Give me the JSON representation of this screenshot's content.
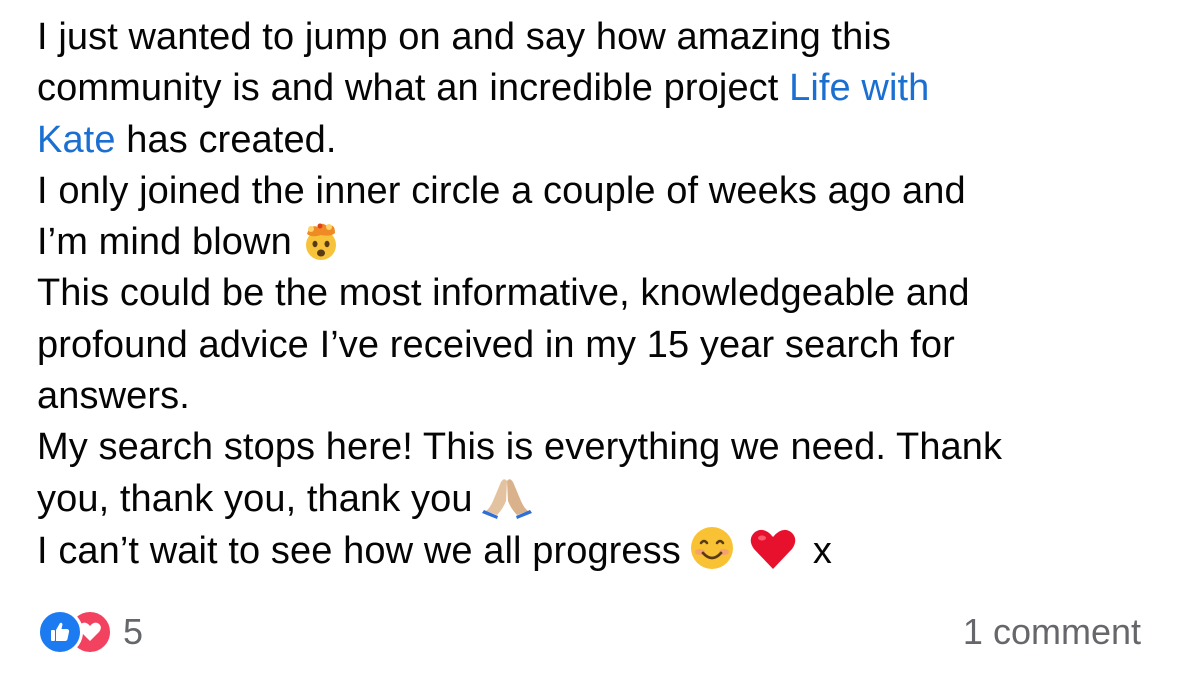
{
  "post": {
    "line1": "I just wanted to jump on and say how amazing this",
    "line2_text": "community is and what an incredible project ",
    "mention_part1": "Life with",
    "mention_part2": "Kate",
    "line3_text": " has created.",
    "line4": "I only joined the inner circle a couple of weeks ago and",
    "line5": "I’m mind blown",
    "line6": "This could be the most informative, knowledgeable and",
    "line7": "profound advice I’ve received in my 15 year search for",
    "line8": "answers.",
    "line9": "My search stops here! This is everything we need. Thank",
    "line10": "you, thank you, thank you",
    "line11": "I can’t wait to see how we all progress",
    "line11_end": "x",
    "emojis": [
      "exploding-head-emoji",
      "folded-hands-emoji",
      "smiling-face-emoji",
      "red-heart-emoji"
    ]
  },
  "footer": {
    "reaction_icons": [
      "like-icon",
      "love-icon"
    ],
    "reaction_count": "5",
    "comments_label": "1 comment"
  },
  "colors": {
    "mention": "#1a6fd1",
    "like": "#1d7bf2",
    "love": "#f3425f",
    "muted": "#65676b"
  }
}
